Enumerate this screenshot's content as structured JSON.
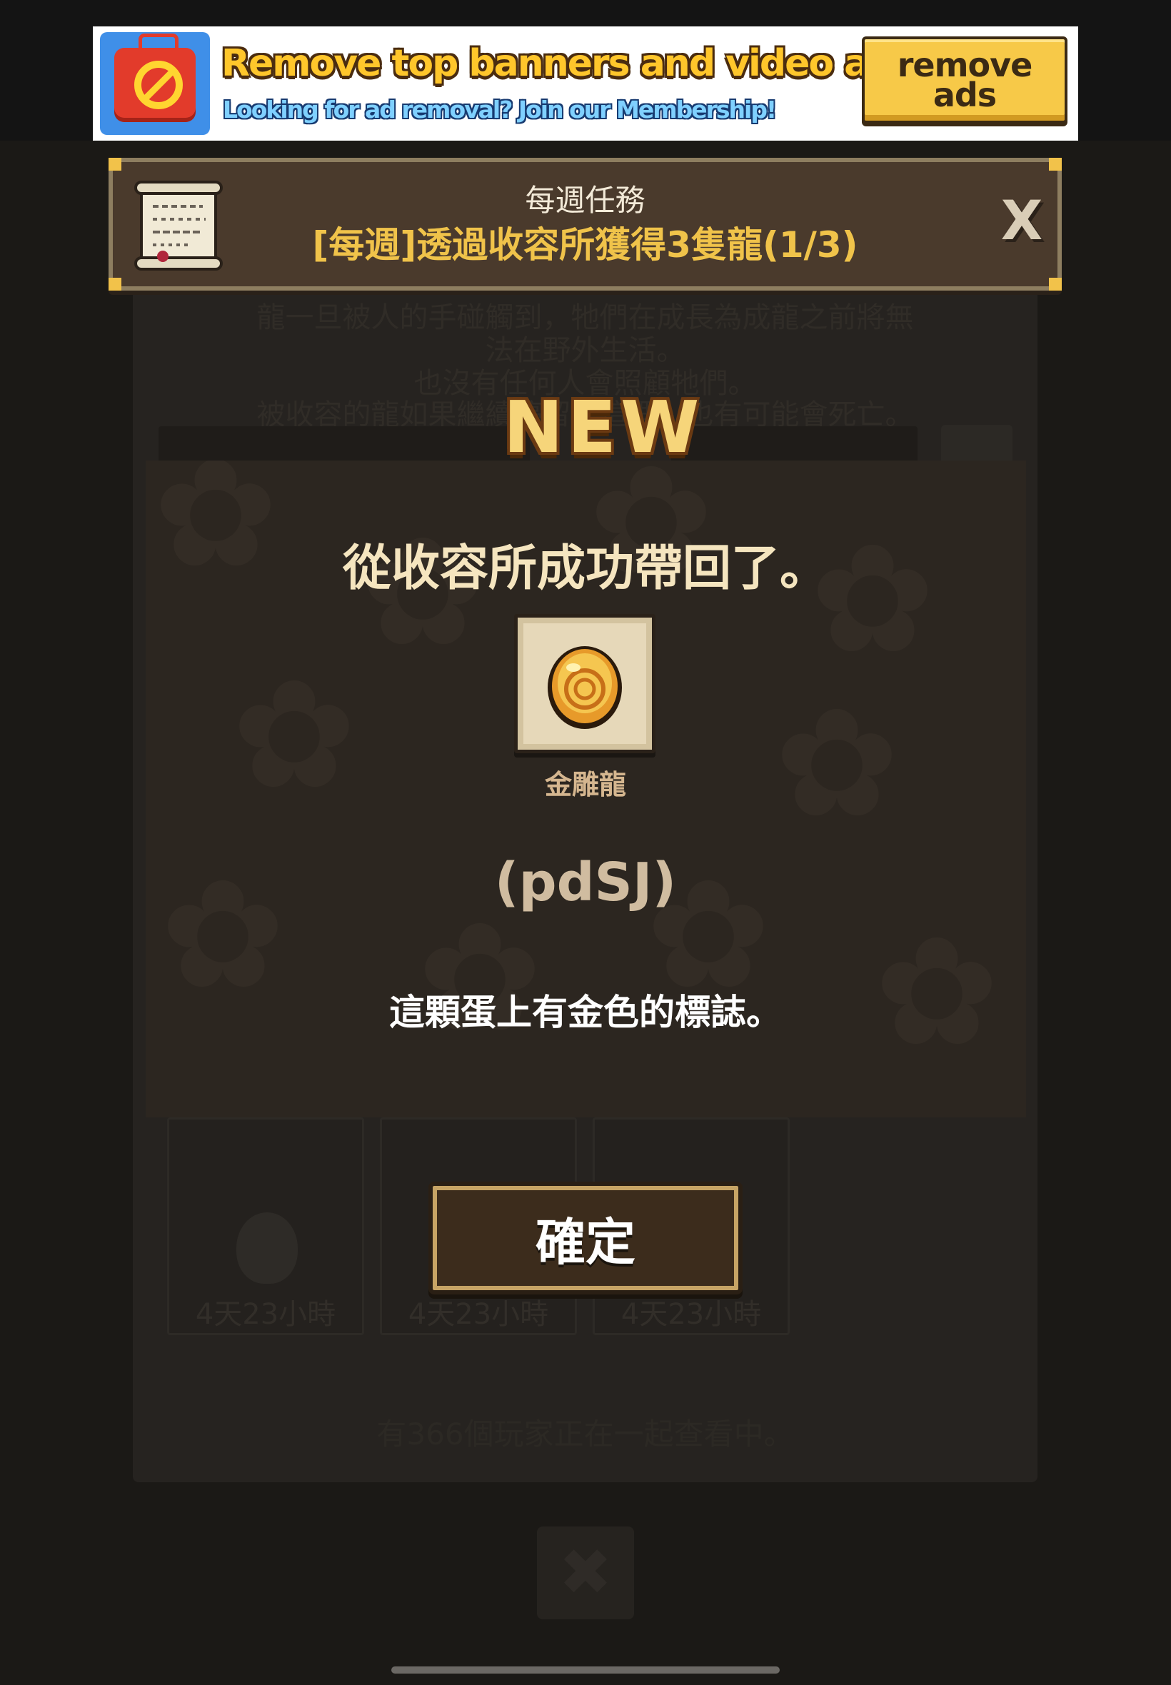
{
  "ad": {
    "title": "Remove top banners and video ads!",
    "subtitle": "Looking for ad removal? Join our Membership!",
    "button_label": "remove\nads",
    "icon": "tv-no-ads-icon"
  },
  "background": {
    "description_lines": [
      "龍一旦被人的手碰觸到，牠們在成長為成龍之前將無",
      "法在野外生活。",
      "也沒有任何人會照顧牠們。",
      "被收容的龍如果繼續停留在這裡，也有可能會死亡。"
    ],
    "cards": [
      {
        "timer": "4天23小時"
      },
      {
        "timer": "4天23小時"
      },
      {
        "timer": "4天23小時"
      }
    ],
    "viewers_text": "有366個玩家正在一起查看中。",
    "close_icon": "close-icon"
  },
  "quest": {
    "title": "每週任務",
    "text": "[每週]透過收容所獲得3隻龍(1/3)",
    "close_label": "X",
    "icon": "scroll-icon"
  },
  "popup": {
    "badge": "NEW",
    "title": "從收容所成功帶回了。",
    "egg_name": "金雕龍",
    "egg_code": "(pdSJ)",
    "egg_description": "這顆蛋上有金色的標誌。",
    "confirm_label": "確定"
  },
  "colors": {
    "accent_gold": "#f0c34a",
    "panel_brown": "#2c2620",
    "quest_brown": "#4a3a2c"
  }
}
